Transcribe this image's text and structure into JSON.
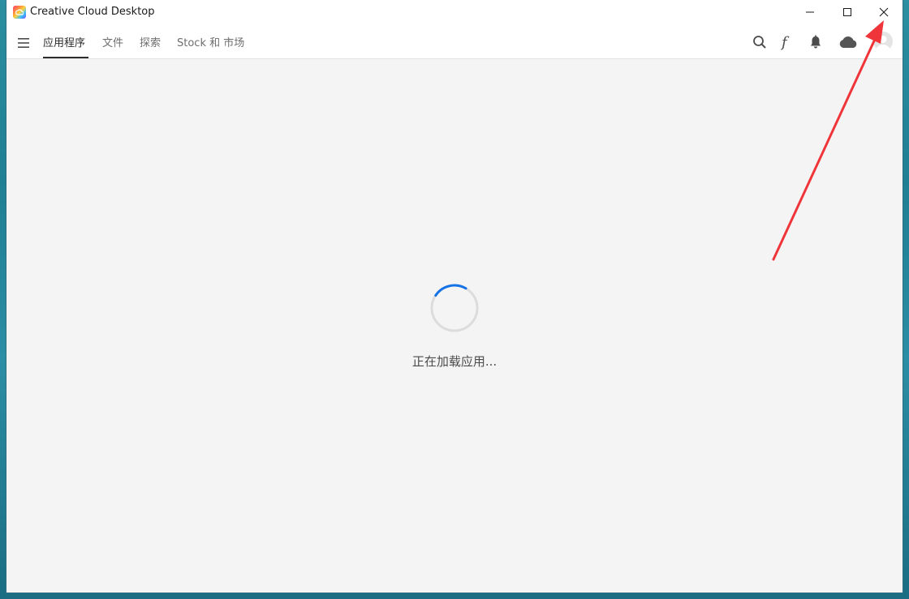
{
  "window": {
    "title": "Creative Cloud Desktop",
    "app_icon": "creative-cloud-logo"
  },
  "window_controls": {
    "minimize_icon": "minimize-icon",
    "maximize_icon": "maximize-icon",
    "close_icon": "close-icon"
  },
  "nav": {
    "menu_icon": "hamburger-menu-icon",
    "tabs": [
      {
        "label": "应用程序",
        "active": true
      },
      {
        "label": "文件",
        "active": false
      },
      {
        "label": "探索",
        "active": false
      },
      {
        "label": "Stock 和 市场",
        "active": false
      }
    ],
    "right_icons": [
      "search-icon",
      "fonts-icon",
      "bell-icon",
      "cloud-icon",
      "avatar"
    ]
  },
  "main": {
    "loading_text": "正在加载应用...",
    "spinner_color": "#1473e6"
  },
  "colors": {
    "accent": "#1473e6",
    "annotation_arrow": "#f0353a",
    "background": "#f4f4f4"
  }
}
